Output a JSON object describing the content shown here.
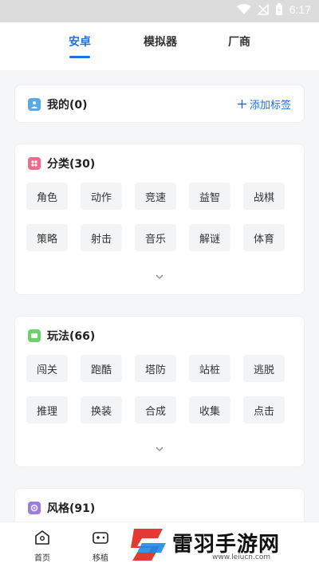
{
  "status_bar": {
    "time": "6:17"
  },
  "top_tabs": [
    {
      "label": "安卓",
      "active": true
    },
    {
      "label": "模拟器",
      "active": false
    },
    {
      "label": "厂商",
      "active": false
    }
  ],
  "my_tags": {
    "title": "我的(0)",
    "add_label": "添加标签"
  },
  "categories": {
    "title": "分类(30)",
    "tags": [
      "角色",
      "动作",
      "竞速",
      "益智",
      "战棋",
      "策略",
      "射击",
      "音乐",
      "解谜",
      "体育"
    ]
  },
  "gameplay": {
    "title": "玩法(66)",
    "tags": [
      "闯关",
      "跑酷",
      "塔防",
      "站桩",
      "逃脱",
      "推理",
      "换装",
      "合成",
      "收集",
      "点击"
    ]
  },
  "style": {
    "title": "风格(91)"
  },
  "bottom_nav": [
    {
      "label": "首页",
      "icon": "home-icon"
    },
    {
      "label": "移植",
      "icon": "gamepad-icon"
    }
  ],
  "watermark": {
    "text": "雷羽手游网",
    "url": "www.leiucn.com"
  },
  "colors": {
    "accent": "#1f6fe0",
    "my_icon": "#5aa9e6",
    "category_icon": "#f06a8c",
    "gameplay_icon": "#6fcf6a",
    "style_icon": "#9b7de0"
  }
}
